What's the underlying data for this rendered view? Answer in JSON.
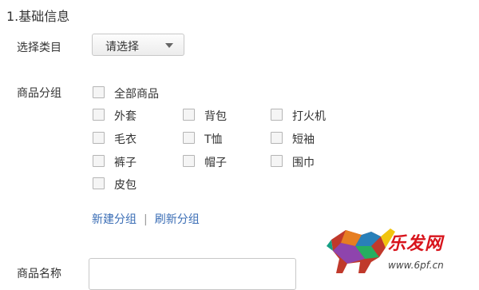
{
  "section": {
    "title": "1.基础信息"
  },
  "category": {
    "label": "选择类目",
    "select_value": "请选择",
    "icon": "caret-down-icon"
  },
  "group": {
    "label": "商品分组",
    "options": [
      "全部商品",
      "外套",
      "背包",
      "打火机",
      "毛衣",
      "T恤",
      "短袖",
      "裤子",
      "帽子",
      "围巾",
      "皮包"
    ],
    "new_link": "新建分组",
    "separator": "|",
    "refresh_link": "刷新分组"
  },
  "name": {
    "label": "商品名称",
    "value": ""
  },
  "watermark": {
    "logo_text": "乐发网",
    "url": "www.6pf.cn"
  },
  "colors": {
    "link": "#3a6db5",
    "watermark_red": "#d8141c"
  }
}
